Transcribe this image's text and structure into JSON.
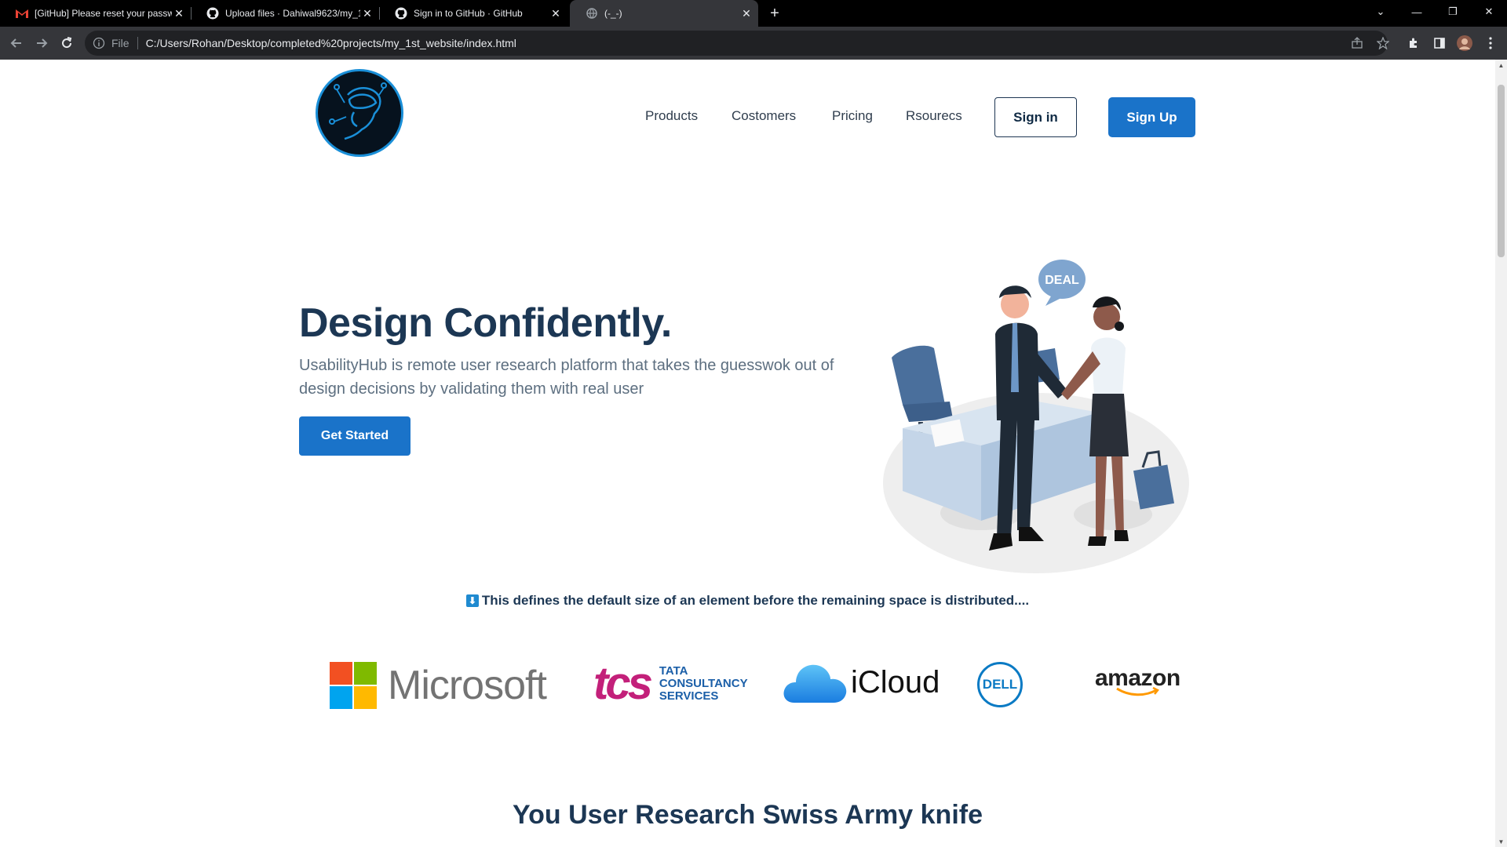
{
  "tabs": [
    {
      "title": "[GitHub] Please reset your passw",
      "icon": "gmail-icon"
    },
    {
      "title": "Upload files · Dahiwal9623/my_1",
      "icon": "github-icon"
    },
    {
      "title": "Sign in to GitHub · GitHub",
      "icon": "github-icon"
    },
    {
      "title": "(-_-)",
      "icon": "globe-icon",
      "active": true
    }
  ],
  "address_bar": {
    "scheme_label": "File",
    "url": "C:/Users/Rohan/Desktop/completed%20projects/my_1st_website/index.html"
  },
  "nav": {
    "links": [
      "Products",
      "Costomers",
      "Pricing",
      "Rsourecs"
    ],
    "sign_in": "Sign in",
    "sign_up": "Sign Up"
  },
  "hero": {
    "title": "Design Confidently.",
    "subtitle": "UsabilityHub is remote user research platform that takes the guesswok out of design decisions by validating them with real user",
    "cta": "Get Started",
    "illustration_bubble": "DEAL"
  },
  "defines_text": "This defines the default size of an element before the remaining space is distributed....",
  "brands": {
    "microsoft": "Microsoft",
    "tcs_mark": "tcs",
    "tcs_words": [
      "TATA",
      "CONSULTANCY",
      "SERVICES"
    ],
    "icloud": "iCloud",
    "dell": "DELL",
    "amazon": "amazon"
  },
  "section_title": "You User Research Swiss Army knife",
  "colors": {
    "primary": "#1a73c9",
    "heading": "#1c3754",
    "body_text": "#5d6f80",
    "chrome_bg": "#35363a"
  }
}
